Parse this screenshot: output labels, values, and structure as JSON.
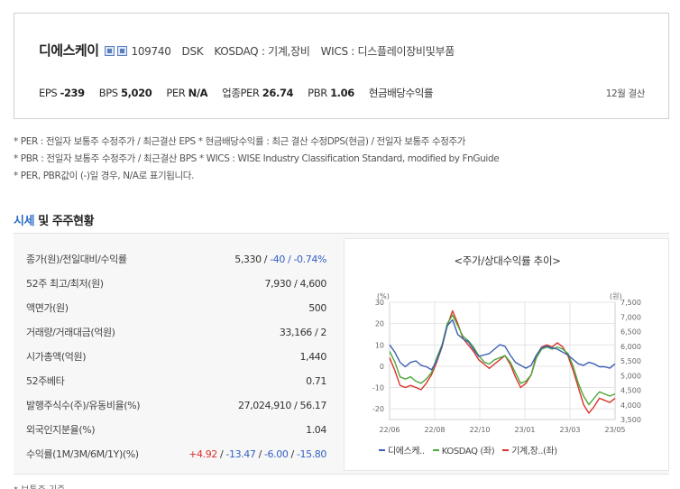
{
  "company": {
    "name": "디에스케이",
    "code": "109740",
    "ticker": "DSK",
    "market": "KOSDAQ : 기계,장비",
    "wics": "WICS : 디스플레이장비및부품"
  },
  "stats": [
    {
      "label": "EPS",
      "value": "-239"
    },
    {
      "label": "BPS",
      "value": "5,020"
    },
    {
      "label": "PER",
      "value": "N/A"
    },
    {
      "label": "업종PER",
      "value": "26.74"
    },
    {
      "label": "PBR",
      "value": "1.06"
    }
  ],
  "dividend_label": "현금배당수익률",
  "settlement": "12월 결산",
  "notes": [
    "* PER : 전일자 보통주 수정주가 / 최근결산 EPS * 현금배당수익률 : 최근 결산 수정DPS(현금) / 전일자 보통주 수정주가",
    "* PBR : 전일자 보통주 수정주가 / 최근결산 BPS * WICS : WISE Industry Classification Standard, modified by FnGuide",
    "* PER, PBR값이 (-)일 경우, N/A로 표기됩니다."
  ],
  "section": {
    "accent": "시세",
    "rest": " 및 주주현황"
  },
  "table": {
    "rows": [
      {
        "label": "종가(원)/전일대비/수익률",
        "value_a": "5,330 / ",
        "value_b": "-40 / -0.74%"
      },
      {
        "label": "52주 최고/최저(원)",
        "value": "7,930 / 4,600"
      },
      {
        "label": "액면가(원)",
        "value": "500"
      },
      {
        "label": "거래량/거래대금(억원)",
        "value": "33,166 / 2"
      },
      {
        "label": "시가총액(억원)",
        "value": "1,440"
      },
      {
        "label": "52주베타",
        "value": "0.71"
      },
      {
        "label": "발행주식수(주)/유동비율(%)",
        "value": "27,024,910 / 56.17"
      },
      {
        "label": "외국인지분율(%)",
        "value": "1.04"
      },
      {
        "label": "수익률(1M/3M/6M/1Y)(%)",
        "returns": [
          {
            "v": "+4.92",
            "c": "pos"
          },
          {
            "v": " / ",
            "c": ""
          },
          {
            "v": "-13.47",
            "c": "neg"
          },
          {
            "v": " / ",
            "c": ""
          },
          {
            "v": "-6.00",
            "c": "neg"
          },
          {
            "v": " / ",
            "c": ""
          },
          {
            "v": "-15.80",
            "c": "neg"
          }
        ]
      }
    ]
  },
  "chart_data": {
    "type": "line",
    "title": "<주가/상대수익률 추이>",
    "left_unit": "(%)",
    "right_unit": "(원)",
    "x_ticks": [
      "22/06",
      "22/08",
      "22/10",
      "23/01",
      "23/03",
      "23/05"
    ],
    "y_left_ticks": [
      30,
      20,
      10,
      0,
      -10,
      -20
    ],
    "y_left_range": [
      -25,
      30
    ],
    "y_right_ticks": [
      "7,500",
      "7,000",
      "6,500",
      "6,000",
      "5,500",
      "5,000",
      "4,500",
      "4,000",
      "3,500"
    ],
    "y_right_range": [
      3500,
      7500
    ],
    "grid": true,
    "legend_position": "bottom",
    "series": [
      {
        "name": "디에스케..",
        "color": "#3b5fb3",
        "axis": "right",
        "values": [
          6050,
          5800,
          5450,
          5300,
          5450,
          5500,
          5350,
          5300,
          5200,
          5500,
          6000,
          6700,
          6900,
          6400,
          6250,
          6150,
          5900,
          5650,
          5700,
          5750,
          5900,
          6050,
          6000,
          5700,
          5450,
          5350,
          5250,
          5350,
          5700,
          5950,
          6000,
          5950,
          5900,
          5800,
          5700,
          5550,
          5400,
          5350,
          5450,
          5400,
          5300,
          5300,
          5250,
          5400
        ]
      },
      {
        "name": "KOSDAQ (좌)",
        "color": "#4aa83a",
        "axis": "left",
        "values": [
          7,
          2,
          -5,
          -6,
          -5,
          -7,
          -8,
          -6,
          -3,
          4,
          10,
          20,
          24,
          19,
          14,
          12,
          9,
          5,
          2,
          1,
          3,
          4,
          5,
          2,
          -3,
          -8,
          -7,
          -4,
          4,
          8,
          9,
          8,
          9,
          8,
          6,
          0,
          -8,
          -14,
          -18,
          -15,
          -12,
          -13,
          -14,
          -13
        ]
      },
      {
        "name": "기계,장..(좌)",
        "color": "#d9342b",
        "axis": "left",
        "values": [
          4,
          -2,
          -9,
          -10,
          -9,
          -10,
          -11,
          -8,
          -4,
          2,
          9,
          19,
          26,
          20,
          13,
          10,
          7,
          3,
          1,
          -1,
          1,
          3,
          5,
          1,
          -5,
          -10,
          -8,
          -4,
          5,
          9,
          10,
          9,
          11,
          9,
          5,
          -2,
          -10,
          -18,
          -22,
          -19,
          -15,
          -16,
          -17,
          -15
        ]
      }
    ]
  },
  "bottom_note": "* 보통주 기준"
}
